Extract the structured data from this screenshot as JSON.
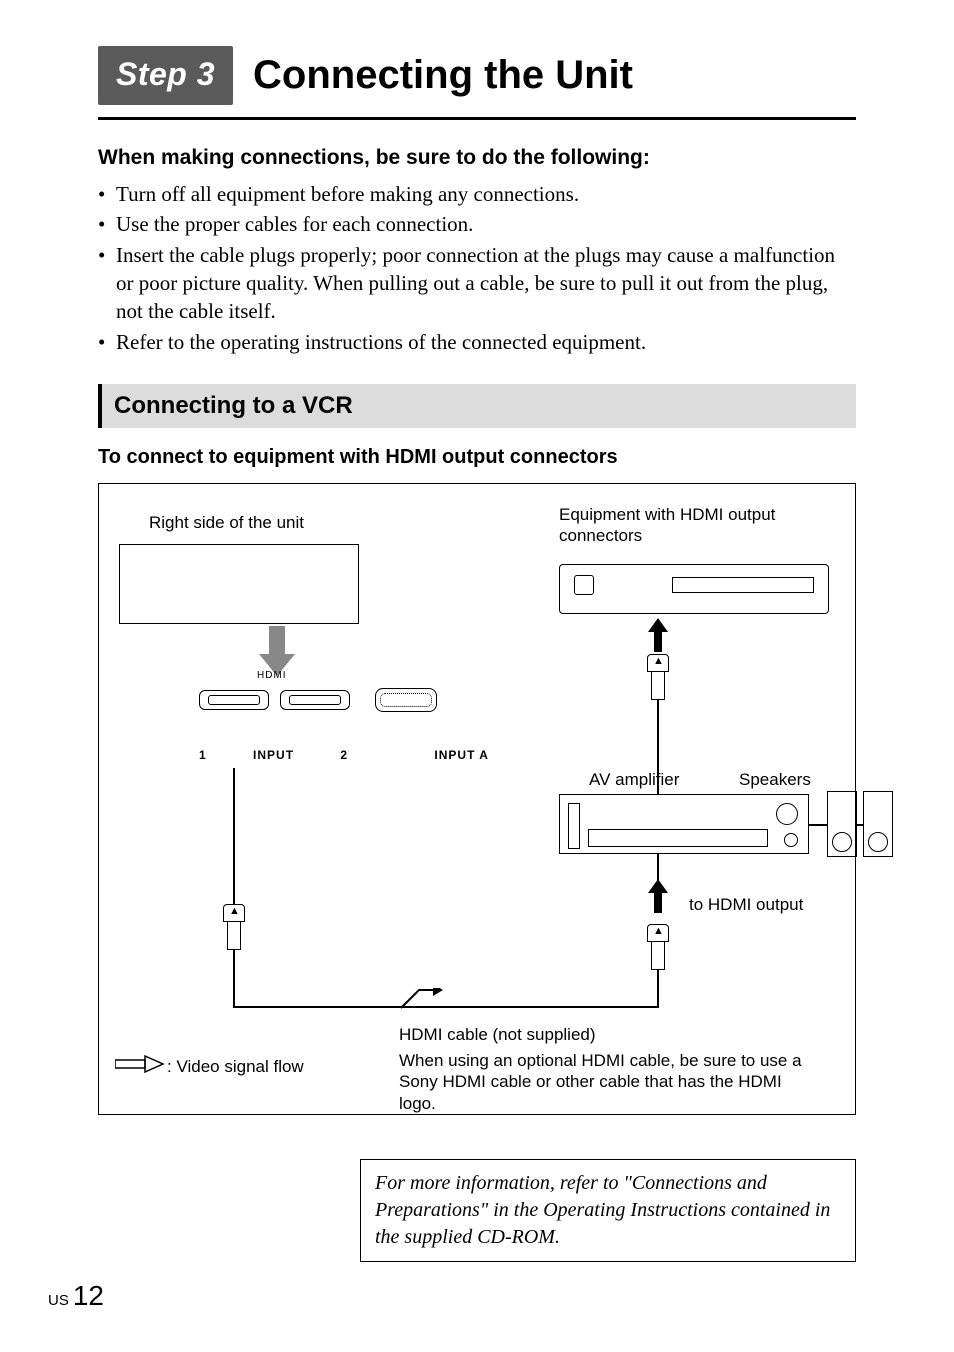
{
  "header": {
    "step_badge": "Step 3",
    "page_title": "Connecting the Unit"
  },
  "intro": {
    "lead": "When making connections, be sure to do the following:",
    "bullets": [
      "Turn off all equipment before making any connections.",
      "Use the proper cables for each connection.",
      "Insert the cable plugs properly; poor connection at the plugs may cause a malfunction or poor picture quality. When pulling out a cable, be sure to pull it out from the plug, not the cable itself.",
      "Refer to the operating instructions of the connected equipment."
    ]
  },
  "section": {
    "title": "Connecting to a VCR",
    "subhead": "To connect to equipment with HDMI output connectors"
  },
  "diagram": {
    "labels": {
      "unit_side": "Right side of the unit",
      "hdmi_equipment": "Equipment with HDMI output connectors",
      "av_amplifier": "AV amplifier",
      "speakers": "Speakers",
      "to_hdmi_output": "to HDMI output",
      "hdmi_cable": "HDMI cable (not supplied)",
      "signal_flow_legend": ": Video signal flow",
      "hdmi_note": "When using an optional HDMI cable, be sure to use a Sony HDMI cable or other cable that has the HDMI logo.",
      "port_input_1": "1",
      "port_input": "INPUT",
      "port_input_2": "2",
      "port_input_a": "INPUT A",
      "hdmi_logo": "HDMI"
    }
  },
  "footer_note": "For more information, refer to \"Connections and Preparations\" in the Operating Instructions contained in the supplied CD-ROM.",
  "page_number": {
    "prefix": "US",
    "num": "12"
  }
}
